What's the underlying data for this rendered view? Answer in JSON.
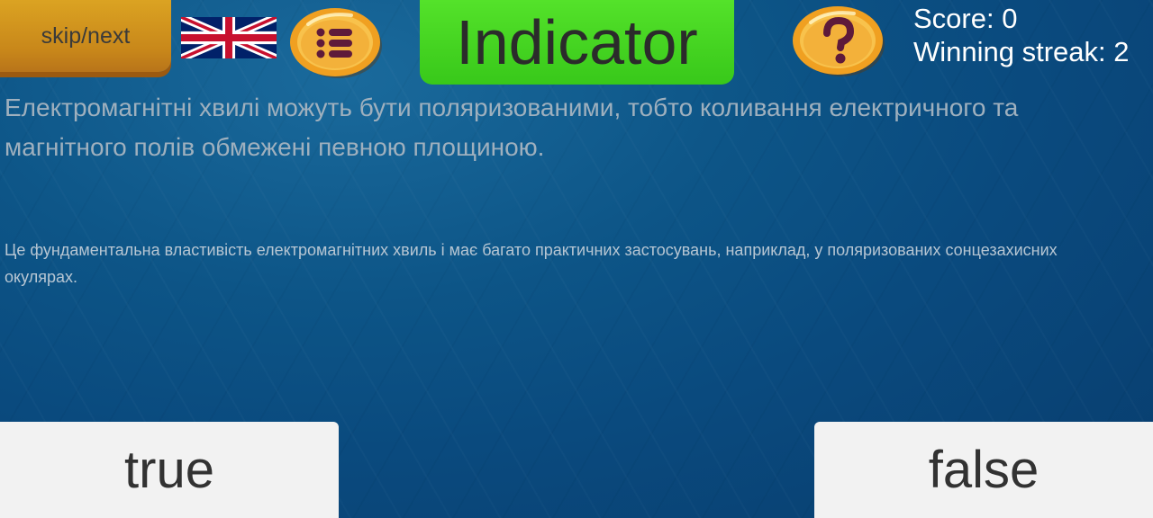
{
  "toolbar": {
    "skip_label": "skip/next",
    "language_icon": "uk-flag-icon",
    "list_icon": "list-icon",
    "help_icon": "question-mark-icon"
  },
  "header": {
    "title": "Indicator"
  },
  "stats": {
    "score": "Score: 0",
    "streak": "Winning streak: 2"
  },
  "question": {
    "statement": "Електромагнітні хвилі можуть бути поляризованими, тобто коливання електричного та магнітного полів обмежені певною площиною.",
    "explanation": "Це фундаментальна властивість електромагнітних хвиль і має багато практичних застосувань, наприклад, у поляризованих сонцезахисних окулярах."
  },
  "answers": {
    "true_label": "true",
    "false_label": "false"
  },
  "colors": {
    "background": "#0d5587",
    "title_bg": "#44d422",
    "skip_bg": "#d4961e",
    "coin": "#f2a12a",
    "button_bg": "#f2f2f2"
  }
}
